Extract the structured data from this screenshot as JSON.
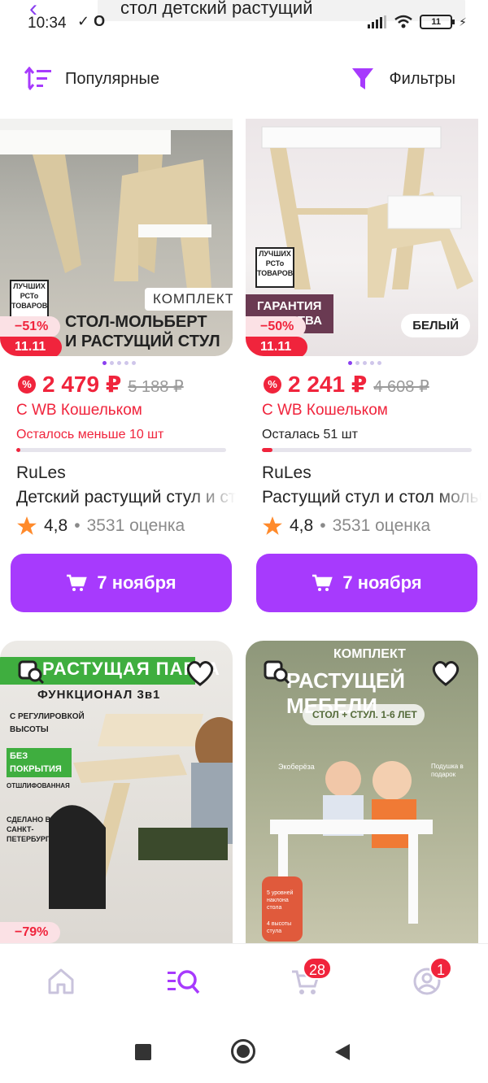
{
  "status_bar": {
    "time": "10:34",
    "battery": "11"
  },
  "search": {
    "query": "стол детский растущий"
  },
  "toolbar": {
    "sort_label": "Популярные",
    "filter_label": "Фильтры"
  },
  "colors": {
    "accent": "#a73afd",
    "price": "#f0243c",
    "rating_star": "#ff8a2b"
  },
  "products": [
    {
      "discount": "−51%",
      "sale_tag": "11.11",
      "image_tag": "КОМПЛЕКТ",
      "image_caption_line1": "СТОЛ-МОЛЬБЕРТ",
      "image_caption_line2": "И РАСТУЩИЙ СТУЛ",
      "seal_text": "ЛУЧШИХ РСТо ТОВАРОВ",
      "price": "2 479 ₽",
      "old_price": "5 188 ₽",
      "wallet": "С WB Кошельком",
      "stock": "Осталось меньше 10 шт",
      "stock_fill": 0.01,
      "brand": "RuLes",
      "title": "Детский растущий стул и стол",
      "rating": "4,8",
      "reviews": "3531 оценка",
      "delivery": "7 ноября"
    },
    {
      "discount": "−50%",
      "sale_tag": "11.11",
      "image_tag": "БЕЛЫЙ",
      "image_caption_line1": "ГАРАНТИЯ",
      "image_caption_line2": "КАЧЕСТВА",
      "seal_text": "ЛУЧШИХ РСТо ТОВАРОВ",
      "price": "2 241 ₽",
      "old_price": "4 608 ₽",
      "wallet": "С WB Кошельком",
      "stock": "Осталась 51 шт",
      "stock_fill": 0.05,
      "brand": "RuLes",
      "title": "Растущий стул и стол мольберт",
      "rating": "4,8",
      "reviews": "3531 оценка",
      "delivery": "7 ноября"
    },
    {
      "image_title": "РАСТУЩАЯ ПАРТА",
      "image_sub": "ФУНКЦИОНАЛ 3в1",
      "image_note1": "С РЕГУЛИРОВКОЙ ВЫСОТЫ",
      "image_note2": "БЕЗ ПОКРЫТИЯ",
      "image_note3": "ОТШЛИФОВАННАЯ",
      "image_note4": "СДЕЛАНО В САНКТ-ПЕТЕРБУРГЕ",
      "discount": "−79%"
    },
    {
      "image_title_top": "КОМПЛЕКТ",
      "image_title": "РАСТУЩЕЙ МЕБЕЛИ",
      "image_sub": "СТОЛ + СТУЛ. 1-6 ЛЕТ",
      "image_note1": "Экоберёза",
      "image_note2": "Подушка в подарок",
      "image_note3": "5 уровней наклона стола",
      "image_note4": "4 высоты стула"
    }
  ],
  "bottom_nav": {
    "cart_count": "28",
    "profile_count": "1"
  }
}
